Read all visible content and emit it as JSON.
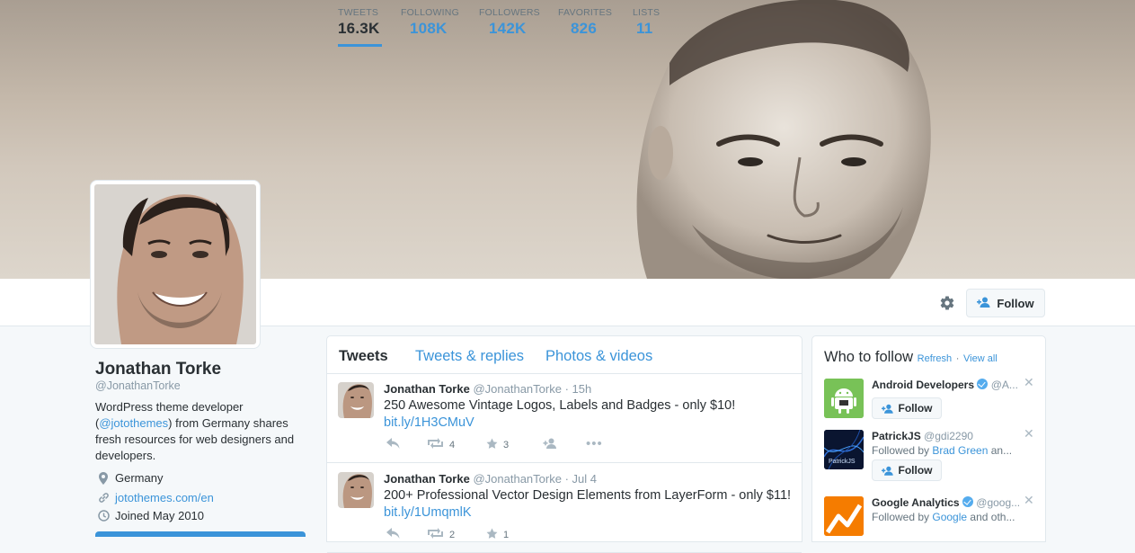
{
  "profile": {
    "name": "Jonathan Torke",
    "handle": "@JonathanTorke",
    "bio_pre": "WordPress theme developer (",
    "bio_mention": "@jotothemes",
    "bio_post": ") from Germany shares fresh resources for web designers and developers.",
    "location": "Germany",
    "website": "jotothemes.com/en",
    "joined": "Joined May 2010"
  },
  "stats": [
    {
      "label": "TWEETS",
      "value": "16.3K"
    },
    {
      "label": "FOLLOWING",
      "value": "108K"
    },
    {
      "label": "FOLLOWERS",
      "value": "142K"
    },
    {
      "label": "FAVORITES",
      "value": "826"
    },
    {
      "label": "LISTS",
      "value": "11"
    }
  ],
  "follow_label": "Follow",
  "timeline": {
    "tabs": [
      "Tweets",
      "Tweets & replies",
      "Photos & videos"
    ],
    "tweets": [
      {
        "name": "Jonathan Torke",
        "handle": "@JonathanTorke",
        "time": "· 15h",
        "text": "250 Awesome Vintage Logos, Labels and Badges - only $10!",
        "link": "bit.ly/1H3CMuV",
        "retweets": "4",
        "favorites": "3"
      },
      {
        "name": "Jonathan Torke",
        "handle": "@JonathanTorke",
        "time": "· Jul 4",
        "text": "200+ Professional Vector Design Elements from LayerForm - only $11!",
        "link": "bit.ly/1UmqmlK",
        "retweets": "2",
        "favorites": "1"
      }
    ]
  },
  "who_to_follow": {
    "title": "Who to follow",
    "refresh": "Refresh",
    "sep": "·",
    "view_all": "View all",
    "suggestions": [
      {
        "name": "Android Developers",
        "handle": "@A...",
        "verified": true,
        "sub_pre": "",
        "sub_link": "",
        "sub_post": ""
      },
      {
        "name": "PatrickJS",
        "handle": "@gdi2290",
        "verified": false,
        "sub_pre": "Followed by ",
        "sub_link": "Brad Green",
        "sub_post": " an...",
        "avatar_text": "PatrickJS"
      },
      {
        "name": "Google Analytics",
        "handle": "@goog...",
        "verified": true,
        "sub_pre": "Followed by ",
        "sub_link": "Google",
        "sub_post": " and oth..."
      }
    ]
  },
  "colors": {
    "accent": "#3b94d9",
    "android_green": "#78c257",
    "analytics_orange": "#f57c00"
  },
  "icons": [
    "gear-icon",
    "follow-user-icon",
    "location-pin-icon",
    "link-icon",
    "calendar-icon",
    "reply-icon",
    "retweet-icon",
    "favorite-star-icon",
    "follow-icon",
    "more-icon",
    "close-icon",
    "verified-icon",
    "android-icon",
    "analytics-icon"
  ]
}
